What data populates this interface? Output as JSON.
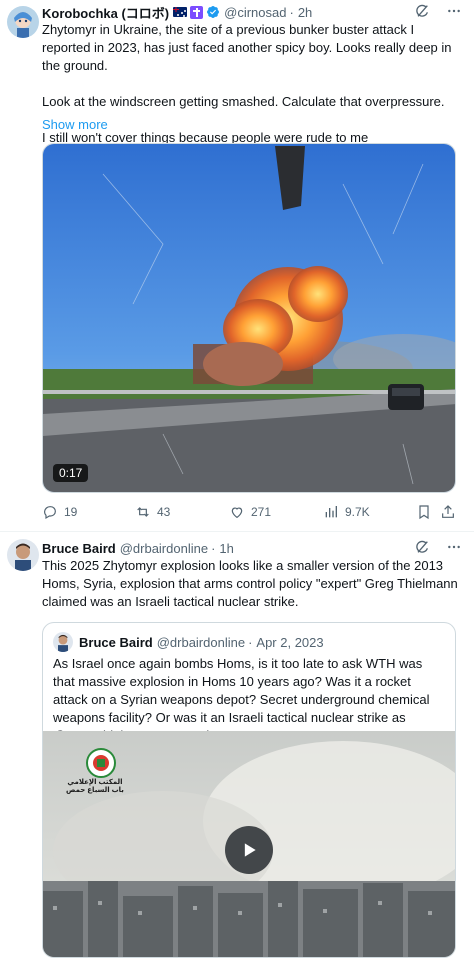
{
  "colors": {
    "accent": "#1d9bf0",
    "muted": "#536471",
    "border": "#cfd9de",
    "text": "#0f1419"
  },
  "tweet1": {
    "author": {
      "name": "Korobochka (コロボ)",
      "handle": "@cirnosad",
      "time": "2h",
      "badges": [
        "australia-flag-icon",
        "cross-badge-icon",
        "verified-badge-icon"
      ]
    },
    "text": "Zhytomyr in Ukraine, the site of a previous bunker buster attack I reported in 2023, has just faced another spicy boy. Looks really deep in the ground.\n\nLook at the windscreen getting smashed. Calculate that overpressure.\n\nI still won't cover things because people were rude to me",
    "show_more": "Show more",
    "video": {
      "duration": "0:17"
    },
    "actions": {
      "replies": "19",
      "reposts": "43",
      "likes": "271",
      "views": "9.7K"
    }
  },
  "tweet2": {
    "author": {
      "name": "Bruce Baird",
      "handle": "@drbairdonline",
      "time": "1h"
    },
    "text": "This 2025 Zhytomyr explosion looks like a smaller version of the 2013 Homs, Syria, explosion that arms control policy \"expert\" Greg Thielmann claimed was an Israeli tactical nuclear strike.",
    "quote": {
      "name": "Bruce Baird",
      "handle": "@drbairdonline",
      "date": "Apr 2, 2023",
      "text": "As Israel once again bombs Homs, is it too late to ask WTH was that massive explosion in Homs 10 years ago? Was it a rocket attack on a Syrian weapons depot? Secret underground chemical weapons facility? Or was it an Israeli tactical nuclear strike as @GregThielmann asserted?",
      "video_logo_text": "المكتب الإعلامي باب السباع حمص"
    }
  }
}
